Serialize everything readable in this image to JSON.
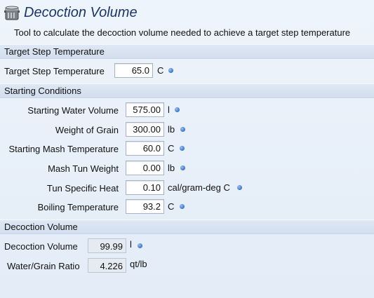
{
  "header": {
    "icon": "cooking-pot-icon",
    "title": "Decoction Volume",
    "subtitle": "Tool to calculate the decoction volume needed to achieve a target step temperature"
  },
  "sections": {
    "target": "Target Step Temperature",
    "starting": "Starting Conditions",
    "decoction": "Decoction Volume"
  },
  "fields": {
    "target_step_temp": {
      "label": "Target Step Temperature",
      "value": "65.0",
      "unit": "C"
    },
    "starting_water_volume": {
      "label": "Starting Water Volume",
      "value": "575.00",
      "unit": "l"
    },
    "weight_of_grain": {
      "label": "Weight of Grain",
      "value": "300.00",
      "unit": "lb"
    },
    "starting_mash_temp": {
      "label": "Starting Mash Temperature",
      "value": "60.0",
      "unit": "C"
    },
    "mash_tun_weight": {
      "label": "Mash Tun Weight",
      "value": "0.00",
      "unit": "lb"
    },
    "tun_specific_heat": {
      "label": "Tun Specific Heat",
      "value": "0.10",
      "unit": "cal/gram-deg C"
    },
    "boiling_temp": {
      "label": "Boiling Temperature",
      "value": "93.2",
      "unit": "C"
    }
  },
  "results": {
    "decoction_volume": {
      "label": "Decoction Volume",
      "value": "99.99",
      "unit": "l"
    },
    "water_grain_ratio": {
      "label": "Water/Grain Ratio",
      "value": "4.226",
      "unit": "qt/lb"
    }
  },
  "colors": {
    "title": "#1a3566",
    "unit_indicator": "#3a72c8",
    "section_bg": "#d8e3f1"
  }
}
